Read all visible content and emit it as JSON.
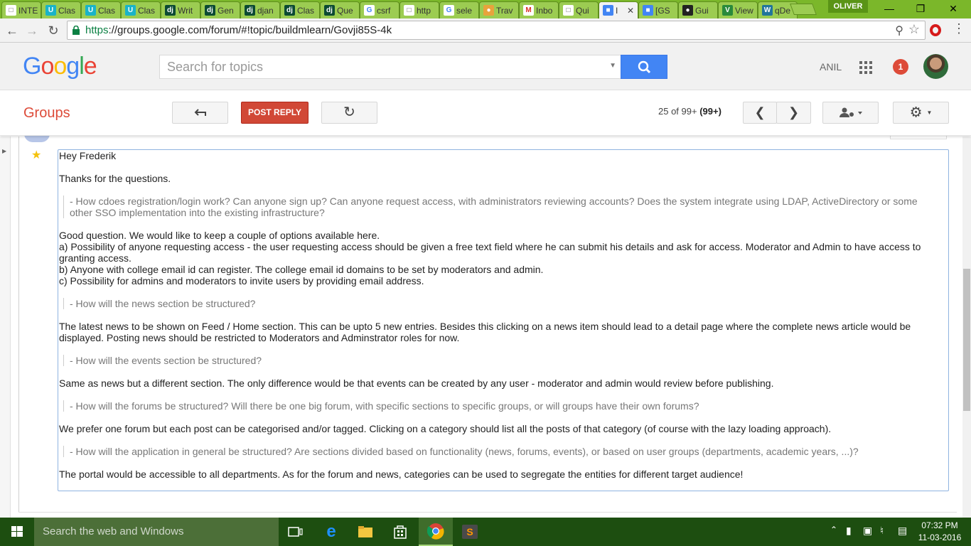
{
  "browser": {
    "tabs": [
      {
        "label": "INTE",
        "icon": "page-icon"
      },
      {
        "label": "Clas",
        "icon": "udemy-icon"
      },
      {
        "label": "Clas",
        "icon": "udemy-icon"
      },
      {
        "label": "Clas",
        "icon": "udemy-icon"
      },
      {
        "label": "Writ",
        "icon": "django-icon"
      },
      {
        "label": "Gen",
        "icon": "django-icon"
      },
      {
        "label": "djan",
        "icon": "django-icon"
      },
      {
        "label": "Clas",
        "icon": "django-icon"
      },
      {
        "label": "Que",
        "icon": "django-icon"
      },
      {
        "label": "csrf",
        "icon": "google-icon"
      },
      {
        "label": "http",
        "icon": "page-icon"
      },
      {
        "label": "sele",
        "icon": "google-icon"
      },
      {
        "label": "Trav",
        "icon": "travel-icon"
      },
      {
        "label": "Inbo",
        "icon": "gmail-icon"
      },
      {
        "label": "Qui",
        "icon": "page-icon"
      },
      {
        "label": "I",
        "icon": "groups-icon",
        "active": true
      },
      {
        "label": "[GS",
        "icon": "groups-icon"
      },
      {
        "label": "Gui",
        "icon": "github-icon"
      },
      {
        "label": "View",
        "icon": "vue-icon"
      },
      {
        "label": "qDe",
        "icon": "wordpress-icon"
      }
    ],
    "profile_name": "OLIVER",
    "url_scheme": "https",
    "url_rest": "://groups.google.com/forum/#!topic/buildmlearn/Govji85S-4k"
  },
  "header": {
    "logo": [
      "G",
      "o",
      "o",
      "g",
      "l",
      "e"
    ],
    "logo_colors": [
      "#4285f4",
      "#ea4335",
      "#fbbc05",
      "#4285f4",
      "#34a853",
      "#ea4335"
    ],
    "search_placeholder": "Search for topics",
    "user_name": "ANIL",
    "notification_count": "1"
  },
  "groups_bar": {
    "title": "Groups",
    "post_reply_label": "POST REPLY",
    "pager_text": "25 of 99+",
    "pager_bold": "(99+)"
  },
  "message": {
    "greeting": "Hey Frederik",
    "thanks": "Thanks for the questions.",
    "q1": "- How cdoes registration/login work? Can anyone sign up? Can anyone request access, with administrators reviewing accounts? Does the system integrate using LDAP, ActiveDirectory or some other SSO implementation into the existing infrastructure?",
    "a1_lines": [
      "Good question. We would like to keep a couple of options available here.",
      "a) Possibility of anyone requesting access - the user requesting access should be given a free text field where he can submit his details and ask for access. Moderator and Admin to have access to granting access.",
      "b) Anyone with college email id can register. The college email id domains to be set by moderators and admin.",
      "c) Possibility for admins and moderators to invite users by providing email address."
    ],
    "q2": "- How will the news section be structured?",
    "a2": "The latest news to be shown on Feed / Home section. This can be upto 5 new entries. Besides this clicking on a news item should lead to a detail page where the complete news article would be displayed. Posting news should be restricted to Moderators and Adminstrator roles for now.",
    "q3": "- How will the events section be structured?",
    "a3": "Same as news but a different section. The only difference would be that events can be created by any user - moderator and admin would review before publishing.",
    "q4": "- How will the forums be structured?  Will there be one big forum, with specific sections to specific groups, or will groups have their own forums?",
    "a4": "We prefer one forum but each post can be categorised and/or tagged. Clicking on a category should list all the posts of that category (of course with the lazy loading approach).",
    "q5": "- How will the application in general be structured? Are sections divided based on functionality (news, forums, events), or based on user groups (departments, academic years, ...)?",
    "a5": "The portal would be accessible to all departments. As for the forum and news, categories can be used to segregate the entities for different target audience!"
  },
  "taskbar": {
    "search_placeholder": "Search the web and Windows",
    "time": "07:32 PM",
    "date": "11-03-2016"
  }
}
